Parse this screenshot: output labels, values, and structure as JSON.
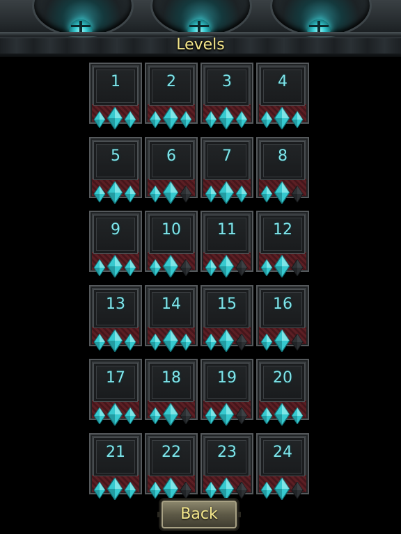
{
  "header": {
    "title": "Levels"
  },
  "levels": [
    {
      "number": "1",
      "gems": [
        true,
        true,
        true
      ]
    },
    {
      "number": "2",
      "gems": [
        true,
        true,
        true
      ]
    },
    {
      "number": "3",
      "gems": [
        true,
        true,
        true
      ]
    },
    {
      "number": "4",
      "gems": [
        true,
        true,
        true
      ]
    },
    {
      "number": "5",
      "gems": [
        true,
        true,
        true
      ]
    },
    {
      "number": "6",
      "gems": [
        true,
        true,
        false
      ]
    },
    {
      "number": "7",
      "gems": [
        true,
        true,
        true
      ]
    },
    {
      "number": "8",
      "gems": [
        true,
        true,
        false
      ]
    },
    {
      "number": "9",
      "gems": [
        true,
        true,
        true
      ]
    },
    {
      "number": "10",
      "gems": [
        true,
        true,
        false
      ]
    },
    {
      "number": "11",
      "gems": [
        true,
        true,
        false
      ]
    },
    {
      "number": "12",
      "gems": [
        true,
        true,
        false
      ]
    },
    {
      "number": "13",
      "gems": [
        true,
        true,
        true
      ]
    },
    {
      "number": "14",
      "gems": [
        true,
        true,
        true
      ]
    },
    {
      "number": "15",
      "gems": [
        true,
        true,
        false
      ]
    },
    {
      "number": "16",
      "gems": [
        true,
        true,
        false
      ]
    },
    {
      "number": "17",
      "gems": [
        true,
        true,
        true
      ]
    },
    {
      "number": "18",
      "gems": [
        true,
        true,
        false
      ]
    },
    {
      "number": "19",
      "gems": [
        true,
        true,
        false
      ]
    },
    {
      "number": "20",
      "gems": [
        true,
        true,
        true
      ]
    },
    {
      "number": "21",
      "gems": [
        true,
        true,
        true
      ]
    },
    {
      "number": "22",
      "gems": [
        true,
        true,
        false
      ]
    },
    {
      "number": "23",
      "gems": [
        true,
        true,
        false
      ]
    },
    {
      "number": "24",
      "gems": [
        true,
        true,
        false
      ]
    }
  ],
  "footer": {
    "back_label": "Back"
  },
  "colors": {
    "gem_earned": "#37c9cf",
    "gem_empty": "#2d3134",
    "number": "#7fe6ec",
    "title": "#f4e68a"
  }
}
